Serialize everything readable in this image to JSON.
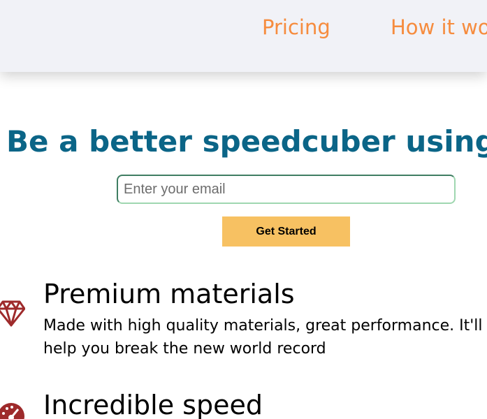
{
  "nav": {
    "items": [
      {
        "label": "Pricing"
      },
      {
        "label": "How it wo"
      }
    ]
  },
  "hero": {
    "title": "Be a better speedcuber using HQ",
    "email_placeholder": "Enter your email",
    "email_value": "",
    "cta_label": "Get Started"
  },
  "features": [
    {
      "icon": "diamond-icon",
      "title": "Premium materials",
      "description": "Made with high quality materials, great performance. It'll help you break the new world record"
    },
    {
      "icon": "speedometer-icon",
      "title": "Incredible speed",
      "description": ""
    }
  ],
  "colors": {
    "nav_link": "#f68c3e",
    "hero_title": "#0b6587",
    "cta_background": "#f7c162",
    "icon": "#9e2a2b",
    "header_background": "#f1f2f7"
  }
}
